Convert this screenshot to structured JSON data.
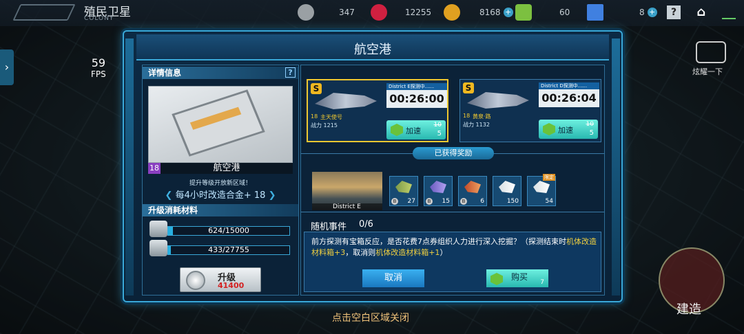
{
  "hud": {
    "title": "殖民卫星",
    "subtitle": "COLONY",
    "resources": [
      {
        "icon": "metal-ore-icon",
        "value": "347",
        "color": "#9aa0a4"
      },
      {
        "icon": "heart-crystal-icon",
        "value": "12255",
        "color": "#d02040"
      },
      {
        "icon": "gold-coin-icon",
        "value": "8168",
        "color": "#e0a020"
      },
      {
        "icon": "green-gem-icon",
        "value": "60",
        "color": "#7cc040"
      },
      {
        "icon": "blue-crystal-icon",
        "value": "8",
        "color": "#4080e0"
      }
    ],
    "help_label": "?",
    "home_label": "⌂"
  },
  "fps": {
    "value": "59",
    "label": "FPS"
  },
  "camera_label": "炫耀一下",
  "build_label": "建造",
  "close_hint": "点击空白区域关闭",
  "dialog": {
    "title": "航空港",
    "details": {
      "heading": "详情信息",
      "help": "?",
      "level": "18",
      "name": "航空港",
      "unlock_text": "提升等级开放新区域！",
      "produce_text": "每4小时改造合金+ 18"
    },
    "materials": {
      "heading": "升级消耗材料",
      "items": [
        {
          "text": "624/15000",
          "progress": 0.04
        },
        {
          "text": "433/27755",
          "progress": 0.02
        }
      ]
    },
    "upgrade": {
      "label": "升级",
      "cost": "41400"
    },
    "ships": [
      {
        "level": "18",
        "name": "主天使号",
        "power_label": "战力",
        "power": "1215",
        "district": "District  E探测中......",
        "timer": "00:26:00",
        "speed_label": "加速",
        "old_cost": "10",
        "new_cost": "5",
        "selected": true
      },
      {
        "level": "18",
        "name": "黄泉·路",
        "power_label": "战力",
        "power": "1132",
        "district": "District  D探测中......",
        "timer": "00:26:04",
        "speed_label": "加速",
        "old_cost": "10",
        "new_cost": "5",
        "selected": false
      }
    ],
    "rewards": {
      "heading": "已获得奖励",
      "district_label": "District E",
      "items": [
        {
          "qty": "27",
          "rank": "B"
        },
        {
          "qty": "15",
          "rank": "B"
        },
        {
          "qty": "6",
          "rank": "B"
        },
        {
          "qty": "150",
          "rank": ""
        },
        {
          "qty": "54",
          "rank": "",
          "tag": "限定"
        }
      ]
    },
    "event": {
      "heading": "随机事件",
      "count": "0/6",
      "text_a": "前方探测有宝箱反应，是否花费7点券组织人力进行深入挖掘？（探测结束时",
      "text_hl1": "机体改造材料箱+3",
      "text_b": "，取消则",
      "text_hl2": "机体改造材料箱+1",
      "text_c": "）",
      "cancel_label": "取消",
      "buy_label": "购买",
      "buy_cost": "7"
    }
  }
}
